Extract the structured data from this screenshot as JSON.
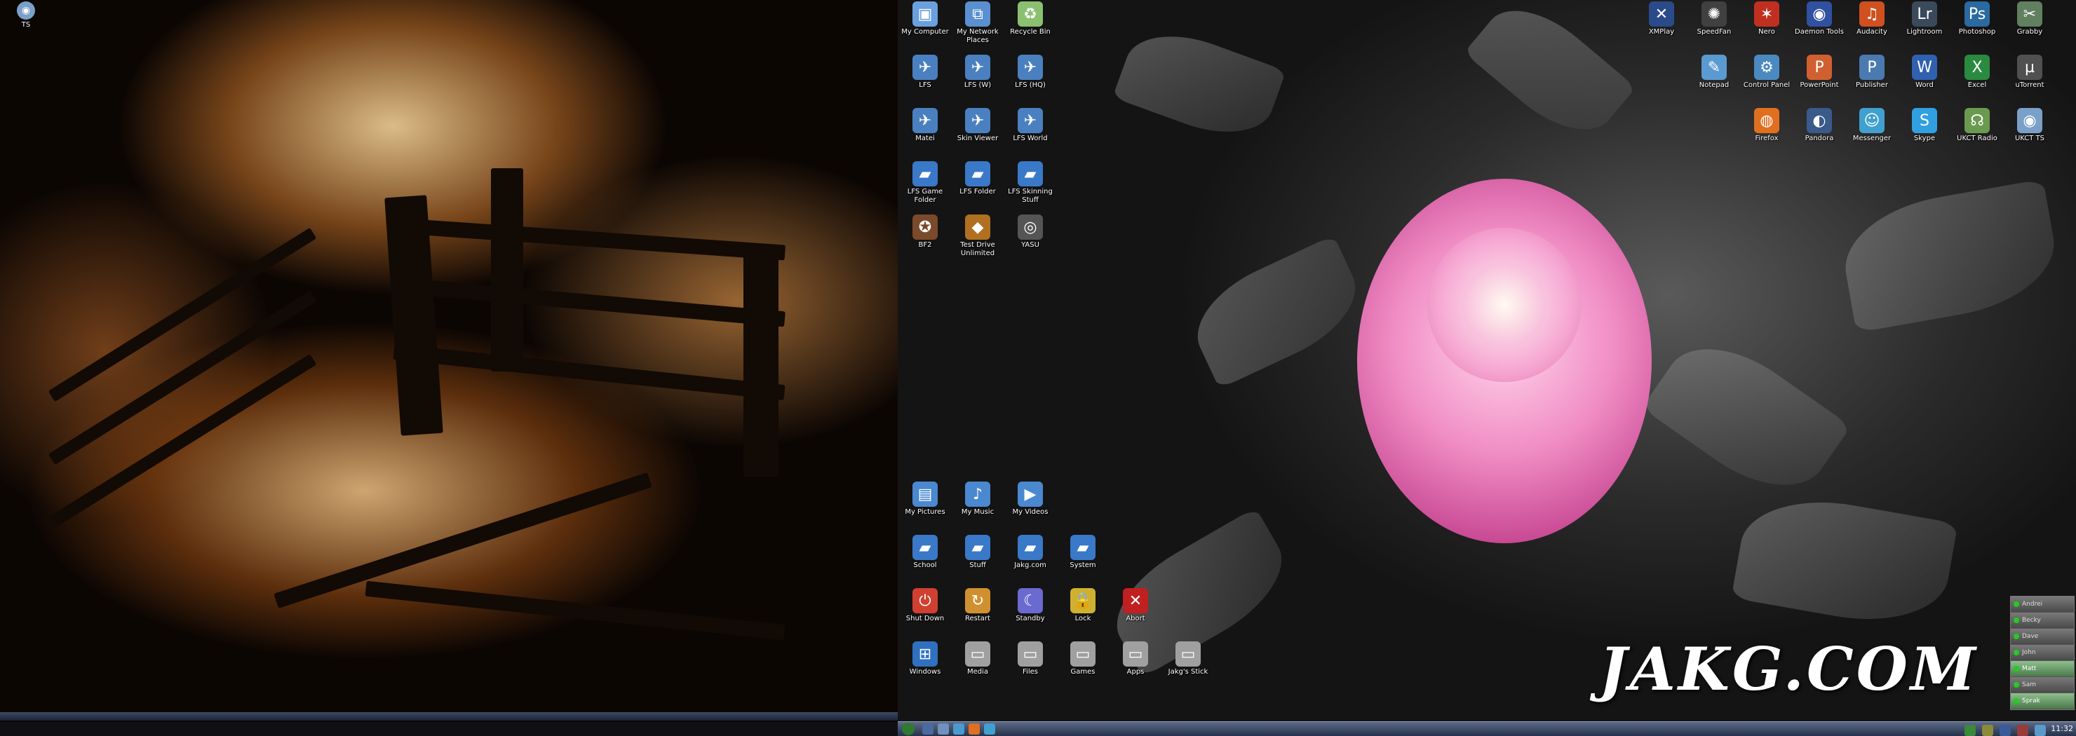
{
  "left_monitor": {
    "desktop_icons": [
      {
        "label": "TS",
        "icon": "teamspeak-icon",
        "color": "#7aa0c8"
      }
    ]
  },
  "right_monitor": {
    "icons_left_grid": [
      {
        "label": "My Computer",
        "icon": "computer-icon",
        "color": "#6aa0e0"
      },
      {
        "label": "My Network Places",
        "icon": "network-icon",
        "color": "#5a90d0"
      },
      {
        "label": "Recycle Bin",
        "icon": "recycle-bin-icon",
        "color": "#8ac070"
      },
      {
        "label": "LFS",
        "icon": "lfs-icon",
        "color": "#4a80c0"
      },
      {
        "label": "LFS (W)",
        "icon": "lfs-icon",
        "color": "#4a80c0"
      },
      {
        "label": "LFS (HQ)",
        "icon": "lfs-icon",
        "color": "#4a80c0"
      },
      {
        "label": "Matei",
        "icon": "lfs-icon",
        "color": "#4a80c0"
      },
      {
        "label": "Skin Viewer",
        "icon": "lfs-icon",
        "color": "#4a80c0"
      },
      {
        "label": "LFS World",
        "icon": "lfs-icon",
        "color": "#4a80c0"
      },
      {
        "label": "LFS Game Folder",
        "icon": "folder-icon",
        "color": "#3a78c8"
      },
      {
        "label": "LFS Folder",
        "icon": "folder-icon",
        "color": "#3a78c8"
      },
      {
        "label": "LFS Skinning Stuff",
        "icon": "folder-icon",
        "color": "#3a78c8"
      },
      {
        "label": "BF2",
        "icon": "bf2-icon",
        "color": "#7a4a2a"
      },
      {
        "label": "Test Drive Unlimited",
        "icon": "tdu-icon",
        "color": "#b07020"
      },
      {
        "label": "YASU",
        "icon": "yasu-icon",
        "color": "#555555"
      }
    ],
    "icons_lower_grid": [
      {
        "label": "My Pictures",
        "icon": "pictures-icon",
        "color": "#4a88d0"
      },
      {
        "label": "My Music",
        "icon": "music-icon",
        "color": "#4a88d0"
      },
      {
        "label": "My Videos",
        "icon": "videos-icon",
        "color": "#4a88d0"
      },
      {
        "label": "School",
        "icon": "folder-icon",
        "color": "#3a78c8"
      },
      {
        "label": "Stuff",
        "icon": "folder-icon",
        "color": "#3a78c8"
      },
      {
        "label": "Jakg.com",
        "icon": "folder-icon",
        "color": "#3a78c8"
      },
      {
        "label": "System",
        "icon": "folder-icon",
        "color": "#3a78c8"
      },
      {
        "label": "Shut Down",
        "icon": "power-icon",
        "color": "#d04030"
      },
      {
        "label": "Restart",
        "icon": "restart-icon",
        "color": "#d09030"
      },
      {
        "label": "Standby",
        "icon": "standby-icon",
        "color": "#6a6ad0"
      },
      {
        "label": "Lock",
        "icon": "lock-icon",
        "color": "#d0b030"
      },
      {
        "label": "Abort",
        "icon": "close-icon",
        "color": "#c02020"
      },
      {
        "label": "Windows",
        "icon": "windows-icon",
        "color": "#3070c0"
      },
      {
        "label": "Media",
        "icon": "drive-icon",
        "color": "#a0a0a0"
      },
      {
        "label": "Files",
        "icon": "drive-icon",
        "color": "#a0a0a0"
      },
      {
        "label": "Games",
        "icon": "drive-icon",
        "color": "#a0a0a0"
      },
      {
        "label": "Apps",
        "icon": "drive-icon",
        "color": "#a0a0a0"
      },
      {
        "label": "Jakg's Stick",
        "icon": "usb-drive-icon",
        "color": "#a0a0a0"
      }
    ],
    "icons_top_right": [
      {
        "label": "XMPlay",
        "icon": "xmplay-icon",
        "color": "#2a4a8a"
      },
      {
        "label": "SpeedFan",
        "icon": "fan-icon",
        "color": "#404040"
      },
      {
        "label": "Nero",
        "icon": "nero-icon",
        "color": "#c03020"
      },
      {
        "label": "Daemon Tools",
        "icon": "daemon-tools-icon",
        "color": "#3050a0"
      },
      {
        "label": "Audacity",
        "icon": "audacity-icon",
        "color": "#d05020"
      },
      {
        "label": "Lightroom",
        "icon": "lightroom-icon",
        "color": "#3a4a5a"
      },
      {
        "label": "Photoshop",
        "icon": "photoshop-icon",
        "color": "#2a6aa0"
      },
      {
        "label": "Grabby",
        "icon": "grabby-icon",
        "color": "#608060"
      },
      {
        "label": "Notepad",
        "icon": "notepad-icon",
        "color": "#5a9ad0"
      },
      {
        "label": "Control Panel",
        "icon": "control-panel-icon",
        "color": "#4a8ac0"
      },
      {
        "label": "PowerPoint",
        "icon": "powerpoint-icon",
        "color": "#d06030"
      },
      {
        "label": "Publisher",
        "icon": "publisher-icon",
        "color": "#4a7ab0"
      },
      {
        "label": "Word",
        "icon": "word-icon",
        "color": "#3060b0"
      },
      {
        "label": "Excel",
        "icon": "excel-icon",
        "color": "#2a8a40"
      },
      {
        "label": "uTorrent",
        "icon": "utorrent-icon",
        "color": "#505050"
      },
      {
        "label": "Firefox",
        "icon": "firefox-icon",
        "color": "#e07020"
      },
      {
        "label": "Pandora",
        "icon": "pandora-icon",
        "color": "#3a5a8a"
      },
      {
        "label": "Messenger",
        "icon": "messenger-icon",
        "color": "#40a0d0"
      },
      {
        "label": "Skype",
        "icon": "skype-icon",
        "color": "#30a0e0"
      },
      {
        "label": "UKCT Radio",
        "icon": "radio-icon",
        "color": "#6a9a50"
      },
      {
        "label": "UKCT TS",
        "icon": "teamspeak-icon",
        "color": "#7aa0c8"
      }
    ],
    "watermark": "JAKG.COM",
    "buddy_list": [
      {
        "name": "Andrei",
        "online": false
      },
      {
        "name": "Becky",
        "online": false
      },
      {
        "name": "Dave",
        "online": false
      },
      {
        "name": "John",
        "online": false
      },
      {
        "name": "Matt",
        "online": true
      },
      {
        "name": "Sam",
        "online": false
      },
      {
        "name": "Sprak",
        "online": true
      }
    ],
    "taskbar": {
      "clock": "11:32",
      "quick_launch": [
        "start-orb-icon",
        "show-desktop-icon",
        "explorer-icon",
        "media-player-icon",
        "firefox-icon",
        "messenger-icon"
      ]
    }
  }
}
